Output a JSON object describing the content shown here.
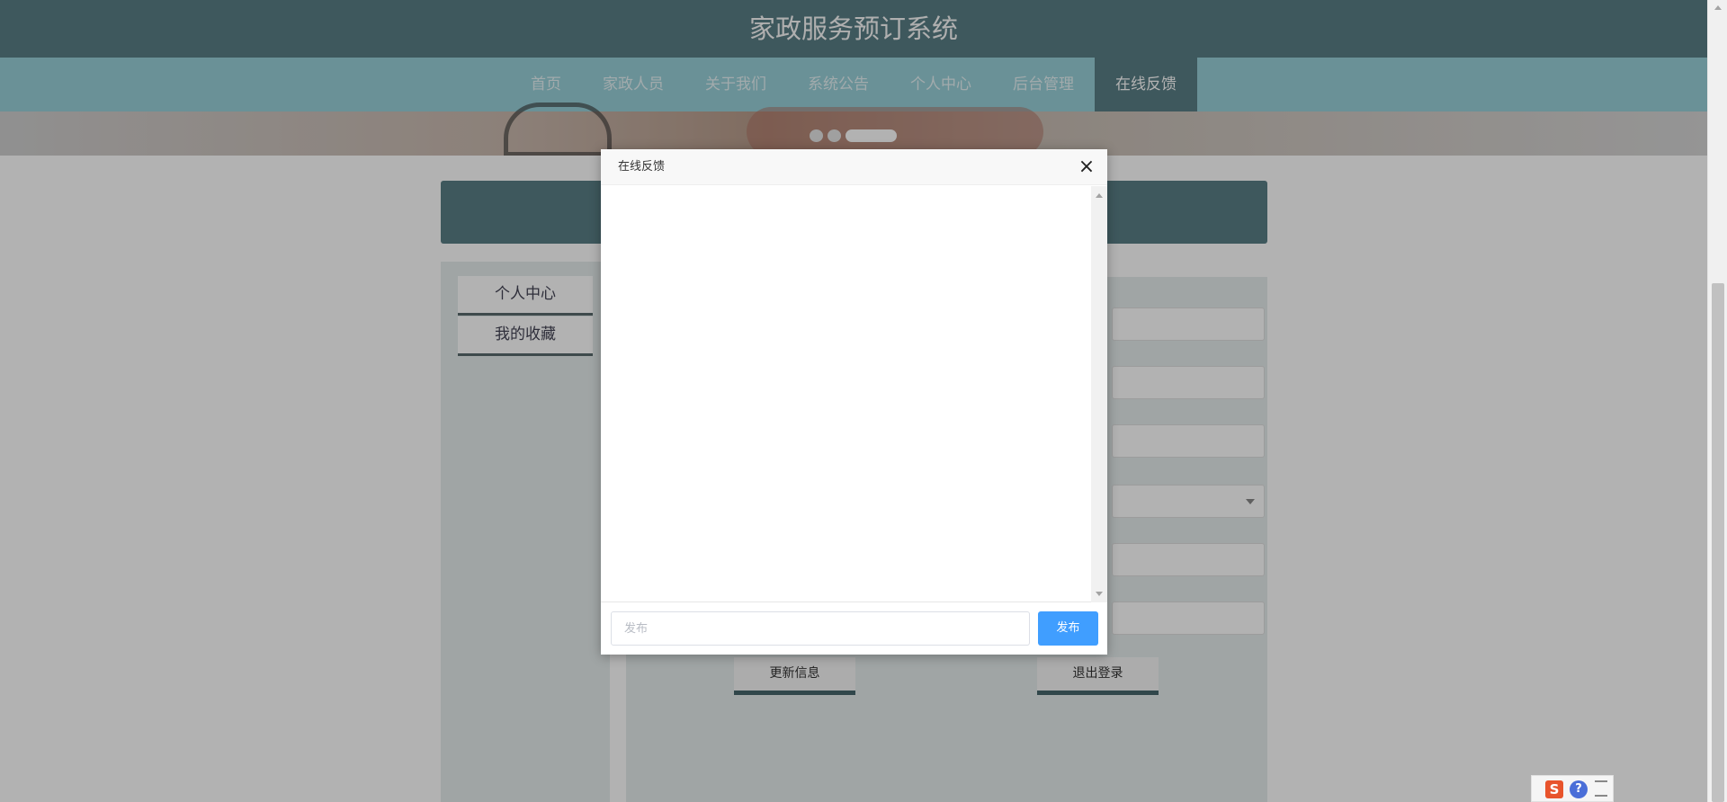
{
  "header": {
    "title": "家政服务预订系统"
  },
  "nav": {
    "items": [
      {
        "label": "首页"
      },
      {
        "label": "家政人员"
      },
      {
        "label": "关于我们"
      },
      {
        "label": "系统公告"
      },
      {
        "label": "个人中心"
      },
      {
        "label": "后台管理"
      },
      {
        "label": "在线反馈"
      }
    ],
    "active_index": 6
  },
  "carousel": {
    "slide_count": 3,
    "active_index": 2
  },
  "sidebar": {
    "items": [
      {
        "label": "个人中心"
      },
      {
        "label": "我的收藏"
      }
    ]
  },
  "form": {
    "update_label": "更新信息",
    "logout_label": "退出登录"
  },
  "dialog": {
    "title": "在线反馈",
    "close_icon": "close-icon",
    "input": {
      "value": "",
      "placeholder": "发布"
    },
    "send_label": "发布"
  },
  "ime": {
    "logo_text": "S",
    "help_text": "?"
  },
  "colors": {
    "header": "#5a7f86",
    "nav": "#99d0d8",
    "accent_button": "#409eff",
    "overlay": "rgba(0,0,0,0.30)"
  }
}
